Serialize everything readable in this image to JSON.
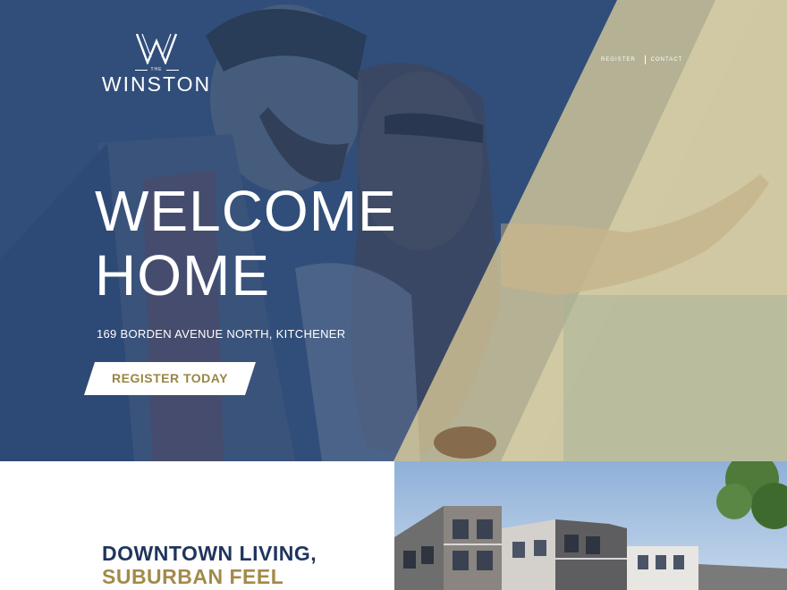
{
  "brand": {
    "small_label": "THE",
    "name": "WINSTON"
  },
  "nav": {
    "register_label": "REGISTER",
    "contact_label": "CONTACT"
  },
  "hero": {
    "title_line1": "WELCOME",
    "title_line2": "HOME",
    "address": "169 BORDEN AVENUE NORTH, KITCHENER",
    "cta_label": "REGISTER TODAY"
  },
  "intro": {
    "line1": "DOWNTOWN LIVING,",
    "line2": "SUBURBAN FEEL"
  },
  "colors": {
    "navy": "#1f355d",
    "gold": "#a38a4a",
    "overlay_blue": "#2f4a72",
    "overlay_gold": "#d8cc9a"
  }
}
